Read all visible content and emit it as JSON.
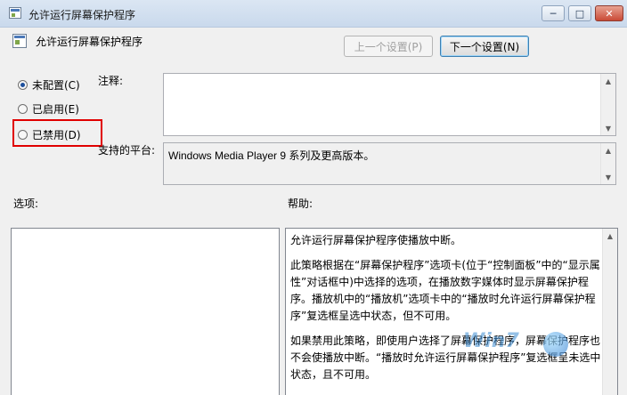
{
  "window": {
    "title": "允许运行屏幕保护程序",
    "controls": {
      "minimize": "─",
      "maximize": "□",
      "close": "✕"
    }
  },
  "header": {
    "policy_title": "允许运行屏幕保护程序",
    "prev_button": "上一个设置(P)",
    "next_button": "下一个设置(N)"
  },
  "state_options": [
    {
      "label": "未配置(C)",
      "selected": true
    },
    {
      "label": "已启用(E)",
      "selected": false
    },
    {
      "label": "已禁用(D)",
      "selected": false
    }
  ],
  "comment": {
    "label": "注释:",
    "value": ""
  },
  "platform": {
    "label": "支持的平台:",
    "value": "Windows Media Player 9 系列及更高版本。"
  },
  "options": {
    "label": "选项:"
  },
  "help": {
    "label": "帮助:",
    "paragraphs": [
      "允许运行屏幕保护程序使播放中断。",
      "此策略根据在“屏幕保护程序”选项卡(位于“控制面板”中的“显示属性”对话框中)中选择的选项，在播放数字媒体时显示屏幕保护程序。播放机中的“播放机”选项卡中的“播放时允许运行屏幕保护程序”复选框呈选中状态，但不可用。",
      "如果禁用此策略，即使用户选择了屏幕保护程序，屏幕保护程序也不会使播放中断。“播放时允许运行屏幕保护程序”复选框呈未选中状态，且不可用。"
    ]
  },
  "watermark": {
    "text": "Win7"
  },
  "colors": {
    "highlight": "#e00000",
    "accent": "#3c7fb1"
  }
}
